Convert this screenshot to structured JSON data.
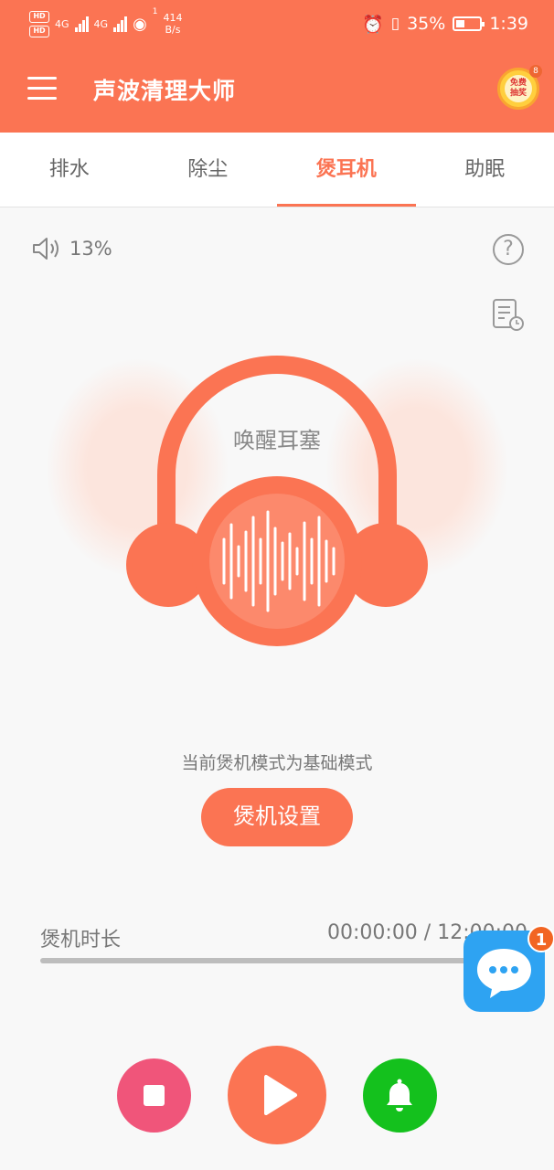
{
  "status_bar": {
    "hd1": "HD",
    "hd2": "HD",
    "net1": "4G",
    "net2": "4G",
    "hotspot_count": "1",
    "speed_value": "414",
    "speed_unit": "B/s",
    "battery_percent": "35%",
    "battery_level": 0.35,
    "time": "1:39"
  },
  "app_bar": {
    "title": "声波清理大师",
    "lottery_line1": "免费",
    "lottery_line2": "抽奖",
    "lottery_badge": "8"
  },
  "tabs": [
    {
      "label": "排水",
      "active": false
    },
    {
      "label": "除尘",
      "active": false
    },
    {
      "label": "煲耳机",
      "active": true
    },
    {
      "label": "助眠",
      "active": false
    }
  ],
  "volume": {
    "value": "13%"
  },
  "help": {
    "symbol": "?"
  },
  "main": {
    "wake_label": "唤醒耳塞",
    "mode_text": "当前煲机模式为基础模式",
    "settings_label": "煲机设置"
  },
  "timer": {
    "label": "煲机时长",
    "value": "00:00:00 / 12:00:00",
    "progress": 0
  },
  "chat": {
    "badge": "1"
  },
  "colors": {
    "accent": "#fb7453",
    "stop": "#f0557a",
    "bell": "#14c11d",
    "chat": "#2ea3f2"
  }
}
